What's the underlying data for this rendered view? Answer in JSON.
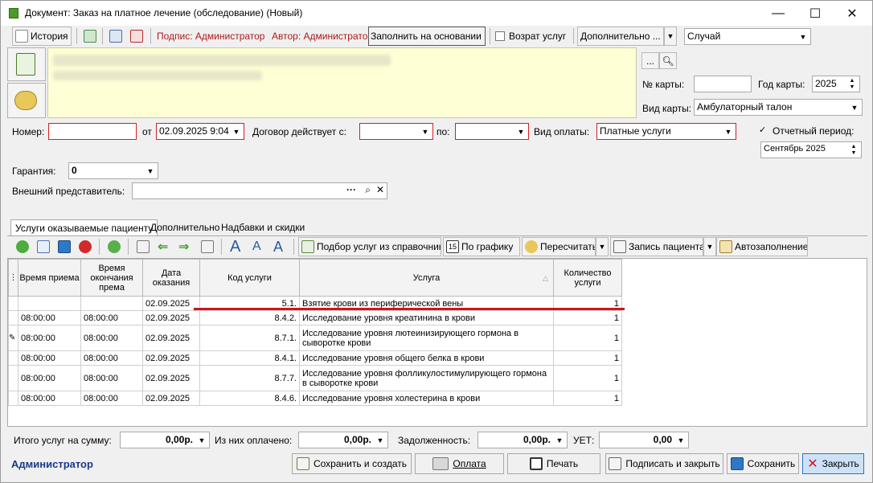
{
  "window": {
    "title": "Документ: Заказ на платное лечение (обследование) (Новый)"
  },
  "toolbar": {
    "history": "История",
    "signature": "Подпис: Администратор",
    "author": "Автор: Администратор",
    "fill_based": "Заполнить на основании ...",
    "return_services": "Возрат услуг",
    "additional": "Дополнительно ...",
    "case_select": "Случай"
  },
  "card": {
    "card_no_label": "№ карты:",
    "card_no_value": "",
    "year_label": "Год карты:",
    "year_value": "2025",
    "type_label": "Вид карты:",
    "type_value": "Амбулаторный талон",
    "dots": "..."
  },
  "form": {
    "number_label": "Номер:",
    "number_value": "",
    "from_label": "от",
    "from_value": "02.09.2025 9:04",
    "contract_label": "Договор действует с:",
    "contract_from": "",
    "to_label": "по:",
    "contract_to": "",
    "payment_label": "Вид оплаты:",
    "payment_value": "Платные услуги",
    "period_label": "Отчетный период:",
    "period_value": "Сентябрь 2025",
    "guarantee_label": "Гарантия:",
    "guarantee_value": "0",
    "ext_rep_label": "Внешний представитель:",
    "ext_rep_value": "",
    "ext_dots": "···"
  },
  "tabs": [
    {
      "label": "Услуги оказываемые пациенту"
    },
    {
      "label": "Дополнительно"
    },
    {
      "label": "Надбавки и скидки"
    }
  ],
  "grid_toolbar": {
    "select_from_ref": "Подбор услуг из справочника",
    "schedule": "По графику",
    "recalc": "Пересчитать",
    "patient_record": "Запись пациента",
    "autofill": "Автозаполнение",
    "schedule_day": "15"
  },
  "table": {
    "headers": [
      "Время приема",
      "Время окончания према",
      "Дата оказания",
      "Код услуги",
      "Услуга",
      "Количество услуги"
    ],
    "rows": [
      [
        "",
        "",
        "02.09.2025",
        "5.1.",
        "Взятие крови из периферической вены",
        "1"
      ],
      [
        "08:00:00",
        "08:00:00",
        "02.09.2025",
        "8.4.2.",
        "Исследование уровня креатинина в крови",
        "1"
      ],
      [
        "08:00:00",
        "08:00:00",
        "02.09.2025",
        "8.7.1.",
        "Исследование уровня лютеинизирующего гормона в сыворотке крови",
        "1"
      ],
      [
        "08:00:00",
        "08:00:00",
        "02.09.2025",
        "8.4.1.",
        "Исследование уровня общего белка в крови",
        "1"
      ],
      [
        "08:00:00",
        "08:00:00",
        "02.09.2025",
        "8.7.7.",
        "Исследование уровня фолликулостимулирующего гормона в сыворотке крови",
        "1"
      ],
      [
        "08:00:00",
        "08:00:00",
        "02.09.2025",
        "8.4.6.",
        "Исследование уровня холестерина в крови",
        "1"
      ]
    ]
  },
  "totals": {
    "sum_label": "Итого услуг на сумму:",
    "sum_value": "0,00р.",
    "paid_label": "Из них оплачено:",
    "paid_value": "0,00р.",
    "debt_label": "Задолженность:",
    "debt_value": "0,00р.",
    "uet_label": "УЕТ:",
    "uet_value": "0,00"
  },
  "footer": {
    "user": "Администратор",
    "save_create": "Сохранить и создать",
    "pay": "Оплата",
    "print": "Печать",
    "sign_close": "Подписать и закрыть",
    "save": "Сохранить",
    "close": "Закрыть"
  },
  "colors": {
    "accent_red": "#d3131a",
    "patient_bg": "#ffffd6",
    "user_blue": "#1a3a8a"
  }
}
